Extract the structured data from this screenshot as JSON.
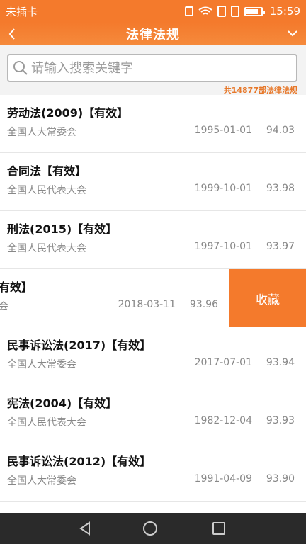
{
  "status_bar": {
    "carrier": "未插卡",
    "time": "15:59"
  },
  "nav": {
    "title": "法律法规"
  },
  "search": {
    "placeholder": "请输入搜索关键字",
    "count_label": "共14877部法律法规"
  },
  "items": [
    {
      "title": "劳动法(2009)【有效】",
      "issuer": "全国人大常委会",
      "date": "1995-01-01",
      "score": "94.03"
    },
    {
      "title": "合同法【有效】",
      "issuer": "全国人民代表大会",
      "date": "1999-10-01",
      "score": "93.98"
    },
    {
      "title": "刑法(2015)【有效】",
      "issuer": "全国人民代表大会",
      "date": "1997-10-01",
      "score": "93.97"
    },
    {
      "title": "有效】",
      "issuer": "会",
      "date": "2018-03-11",
      "score": "93.96",
      "action": "收藏"
    },
    {
      "title": "民事诉讼法(2017)【有效】",
      "issuer": "全国人大常委会",
      "date": "2017-07-01",
      "score": "93.94"
    },
    {
      "title": "宪法(2004)【有效】",
      "issuer": "全国人民代表大会",
      "date": "1982-12-04",
      "score": "93.93"
    },
    {
      "title": "民事诉讼法(2012)【有效】",
      "issuer": "全国人大常委会",
      "date": "1991-04-09",
      "score": "93.90"
    }
  ],
  "colors": {
    "accent": "#f47a2c",
    "count_text": "#e7782a"
  },
  "icons": {
    "back": "chevron-left-icon",
    "menu": "chevron-down-icon",
    "search": "search-icon"
  }
}
